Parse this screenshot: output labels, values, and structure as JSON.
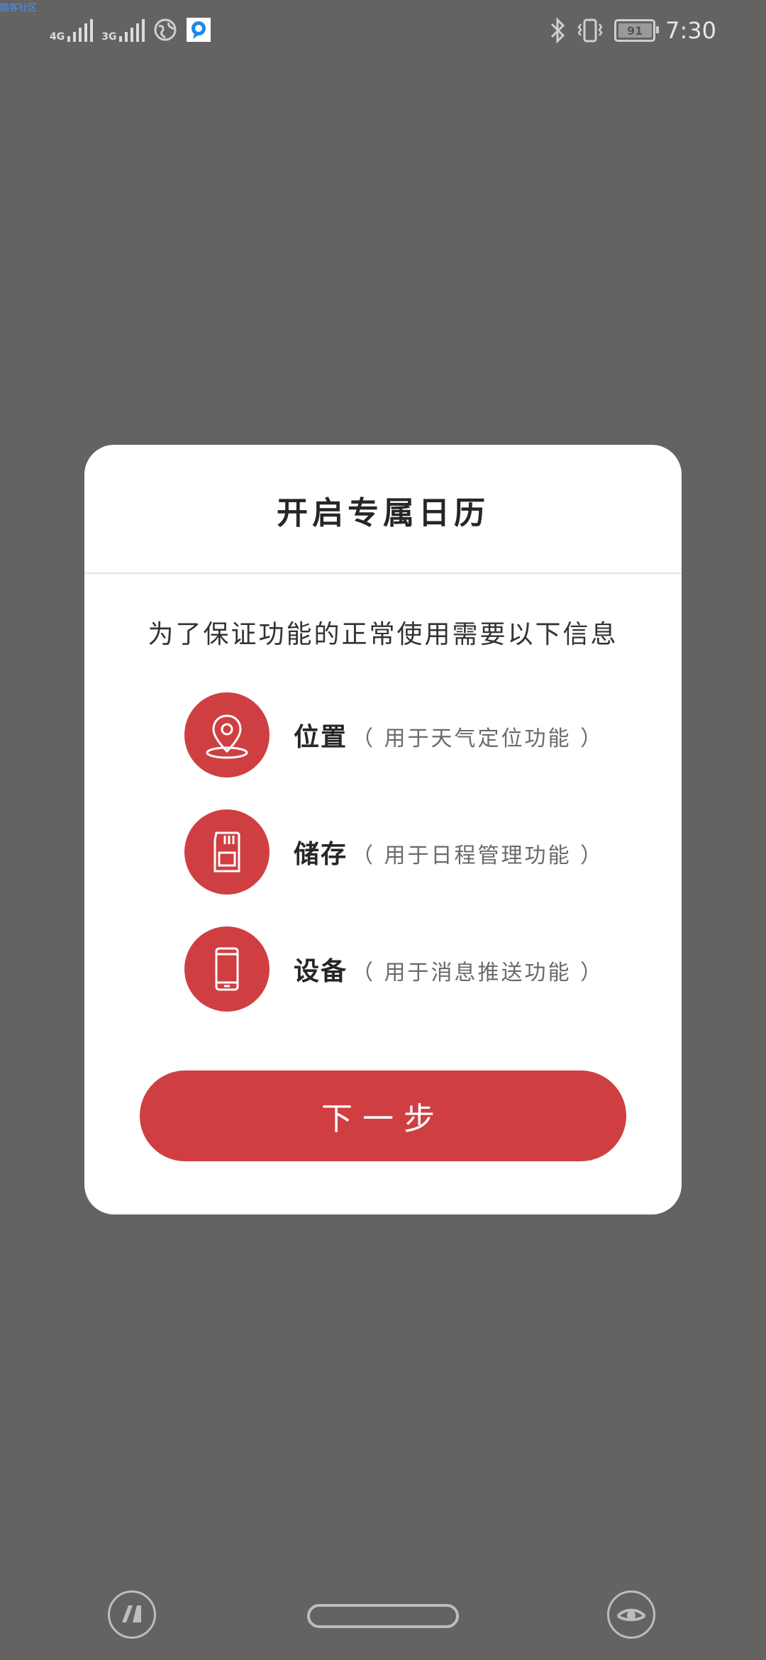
{
  "corner_label": "酷客社区",
  "status_bar": {
    "network_1": "4G",
    "network_2": "3G",
    "battery_level": "91",
    "time": "7:30"
  },
  "dialog": {
    "title": "开启专属日历",
    "subtitle": "为了保证功能的正常使用需要以下信息",
    "permissions": [
      {
        "name": "位置",
        "desc": "（ 用于天气定位功能 ）",
        "icon": "location-pin-icon"
      },
      {
        "name": "储存",
        "desc": "（ 用于日程管理功能 ）",
        "icon": "sd-card-icon"
      },
      {
        "name": "设备",
        "desc": "（ 用于消息推送功能 ）",
        "icon": "phone-icon"
      }
    ],
    "next_label": "下一步"
  },
  "colors": {
    "accent": "#cf3f42",
    "background": "#646361",
    "dialog": "#ffffff"
  }
}
